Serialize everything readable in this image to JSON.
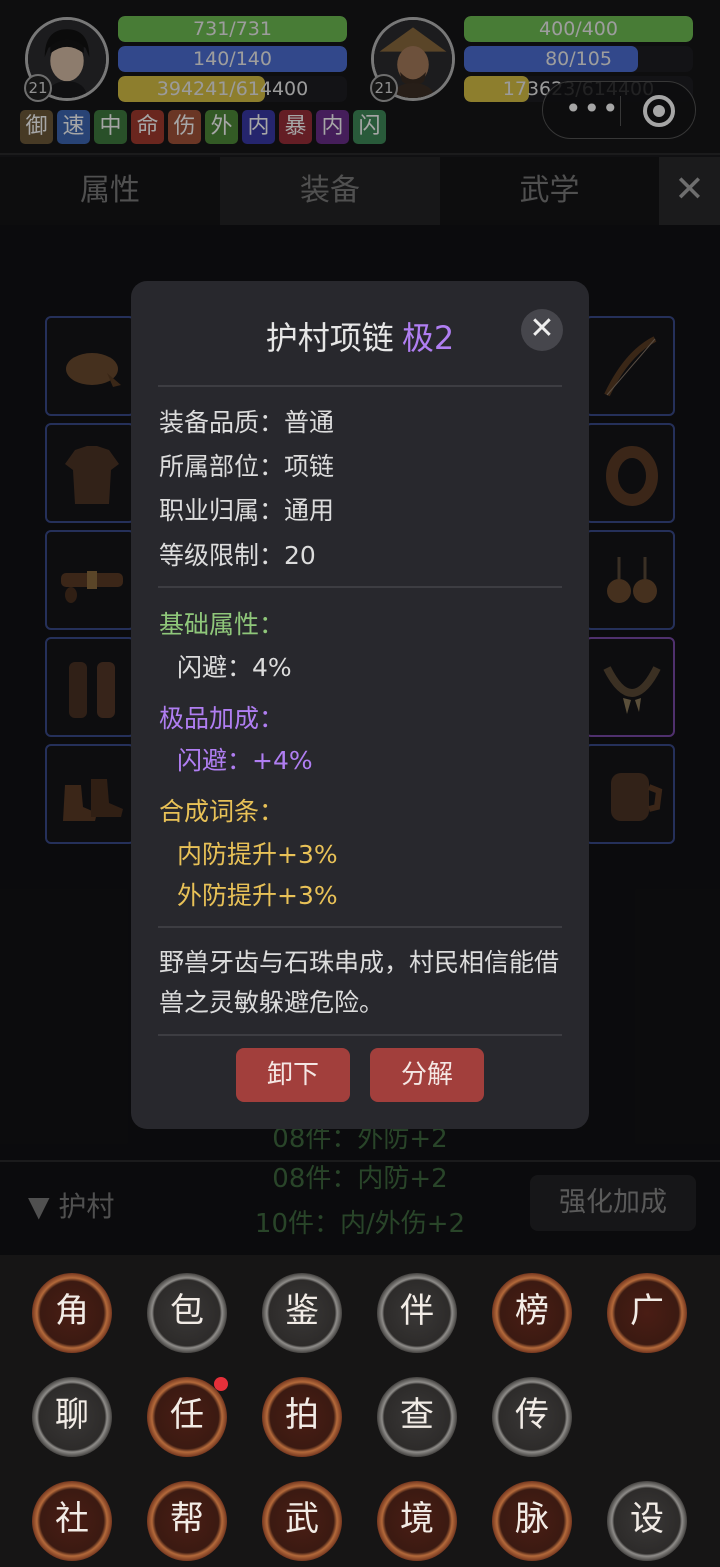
{
  "player": {
    "level": "21",
    "hp": {
      "text": "731/731",
      "fraction": 1.0
    },
    "mp": {
      "text": "140/140",
      "fraction": 1.0
    },
    "xp": {
      "text": "394241/614400",
      "fraction": 0.642
    }
  },
  "companion": {
    "level": "21",
    "hp": {
      "text": "400/400",
      "fraction": 1.0
    },
    "mp": {
      "text": "80/105",
      "fraction": 0.762
    },
    "xp": {
      "text": "173623/614400",
      "fraction": 0.283
    }
  },
  "buff_tags": [
    {
      "label": "御",
      "color": "#6e5a3a"
    },
    {
      "label": "速",
      "color": "#3e68b4"
    },
    {
      "label": "中",
      "color": "#3f7b3f"
    },
    {
      "label": "命",
      "color": "#a33b2f"
    },
    {
      "label": "伤",
      "color": "#a3543a"
    },
    {
      "label": "外",
      "color": "#4f8a3a"
    },
    {
      "label": "内",
      "color": "#3a3aa8"
    },
    {
      "label": "暴",
      "color": "#9a2f3a"
    },
    {
      "label": "内",
      "color": "#6a2f8a"
    },
    {
      "label": "闪",
      "color": "#3f8a5a"
    }
  ],
  "capsule": {
    "dots": "•••"
  },
  "tabs": [
    {
      "label": "属性"
    },
    {
      "label": "装备"
    },
    {
      "label": "武学"
    }
  ],
  "tab_close": "✕",
  "set_panel": {
    "title": "▼ 护村",
    "enhance_button": "强化加成",
    "lines": [
      "08件：外防+2",
      "08件：内防+2",
      "10件：内/外伤+2"
    ]
  },
  "modal": {
    "name": "护村项链",
    "grade": "极2",
    "close": "✕",
    "quality": "装备品质：普通",
    "slot": "所属部位：项链",
    "class": "职业归属：通用",
    "level_req": "等级限制：20",
    "base_header": "基础属性：",
    "base_stat": "闪避：4%",
    "bonus_header": "极品加成：",
    "bonus_stat": "闪避：+4%",
    "affix_header": "合成词条：",
    "affixes": [
      "内防提升+3%",
      "外防提升+3%"
    ],
    "description": "野兽牙齿与石珠串成，村民相信能借兽之灵敏躲避危险。",
    "unequip_button": "卸下",
    "dismantle_button": "分解"
  },
  "menu": [
    "角",
    "包",
    "鉴",
    "伴",
    "榜",
    "广",
    "聊",
    "任",
    "拍",
    "查",
    "传",
    "社",
    "帮",
    "武",
    "境",
    "脉",
    "设"
  ]
}
